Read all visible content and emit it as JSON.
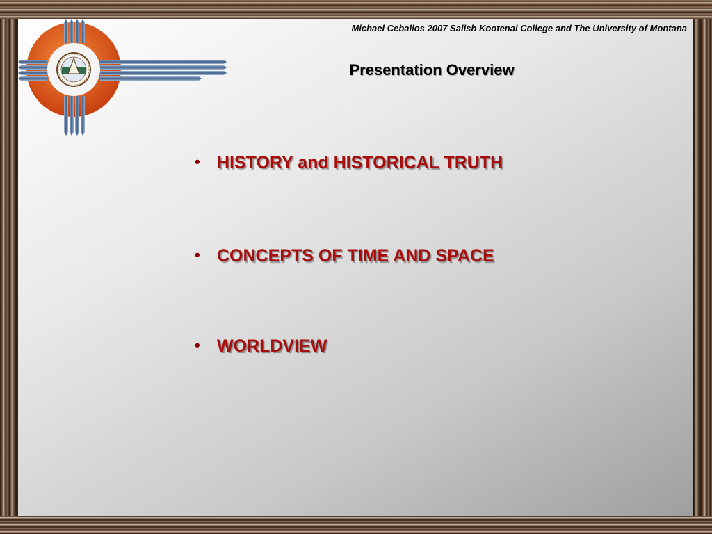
{
  "slide": {
    "credit": "Michael Ceballos 2007 Salish Kootenai College and The University of Montana",
    "title": "Presentation Overview",
    "bullets": [
      {
        "text": "HISTORY and HISTORICAL TRUTH"
      },
      {
        "text": "CONCEPTS OF TIME AND SPACE"
      },
      {
        "text": "WORLDVIEW"
      }
    ],
    "logo_icon": "zia-sun-seal-icon",
    "colors": {
      "bullet_text": "#a80d0d",
      "sun_orange": "#e0551c",
      "ray_blue": "#4a6c96"
    }
  }
}
